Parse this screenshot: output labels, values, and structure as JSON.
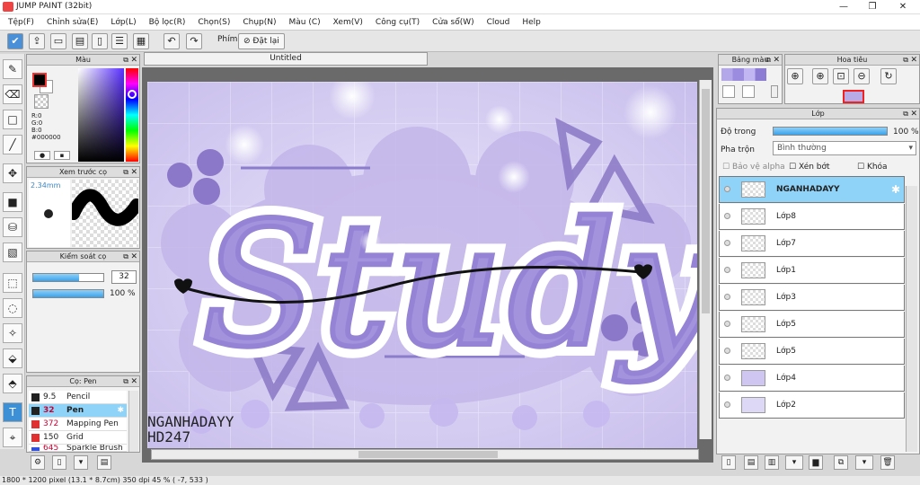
{
  "app": {
    "title": "JUMP PAINT (32bit)"
  },
  "menu": [
    "Tệp(F)",
    "Chỉnh sửa(E)",
    "Lớp(L)",
    "Bộ lọc(R)",
    "Chọn(S)",
    "Chụp(N)",
    "Màu (C)",
    "Xem(V)",
    "Công cụ(T)",
    "Cửa sổ(W)",
    "Cloud",
    "Help"
  ],
  "toolbar": {
    "shortcut_label": "Phím",
    "reset_label": "Đặt lại"
  },
  "color_panel": {
    "title": "Màu",
    "r": "R:0",
    "g": "G:0",
    "b": "B:0",
    "hex": "#000000"
  },
  "preview_panel": {
    "title": "Xem trước cọ",
    "size": "2.34mm"
  },
  "brush_control": {
    "title": "Kiểm soát cọ",
    "size": "32",
    "opacity": "100 %",
    "opacity_value": 100,
    "size_fill": 65
  },
  "brush_list": {
    "title": "Cọ: Pen",
    "items": [
      {
        "size": "9.5",
        "name": "Pencil",
        "color": "#222222"
      },
      {
        "size": "32",
        "name": "Pen",
        "color": "#222222"
      },
      {
        "size": "372",
        "name": "Mapping Pen",
        "color": "#e03030"
      },
      {
        "size": "150",
        "name": "Grid",
        "color": "#e03030"
      },
      {
        "size": "645",
        "name": "Sparkle Brush",
        "color": "#3050e0"
      }
    ]
  },
  "document": {
    "tab": "Untitled",
    "artist": "NGANHADAYY",
    "code": "HD247",
    "art_word": "Study"
  },
  "swatch_panel": {
    "title": "Bảng màu"
  },
  "navigator_panel": {
    "title": "Hoa tiêu"
  },
  "layers_panel": {
    "title": "Lớp",
    "opacity_label": "Độ trong",
    "opacity_value": "100 %",
    "blend_label": "Pha trộn",
    "blend_mode": "Bình thường",
    "protect_alpha": "Bảo vệ alpha",
    "clipping": "Xén bớt",
    "lock": "Khóa",
    "layers": [
      {
        "name": "NGANHADAYY",
        "selected": true
      },
      {
        "name": "Lớp8"
      },
      {
        "name": "Lớp7"
      },
      {
        "name": "Lớp1"
      },
      {
        "name": "Lớp3"
      },
      {
        "name": "Lớp5"
      },
      {
        "name": "Lớp5"
      },
      {
        "name": "Lớp4"
      },
      {
        "name": "Lớp2"
      }
    ]
  },
  "status": {
    "text": "1800 * 1200 pixel  (13.1 * 8.7cm)  350 dpi  45 %  ( -7, 533 )"
  }
}
